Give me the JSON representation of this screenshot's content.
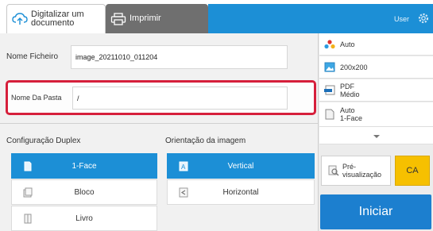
{
  "tabs": {
    "scan_label": "Digitalizar um documento",
    "print_label": "Imprimir"
  },
  "header": {
    "user_label": "User"
  },
  "fields": {
    "file_name_label": "Nome Ficheiro",
    "file_name_value": "image_20211010_011204",
    "folder_name_label": "Nome Da Pasta",
    "folder_name_value": "/"
  },
  "duplex": {
    "title": "Configuração Duplex",
    "options": [
      {
        "label": "1-Face",
        "selected": true
      },
      {
        "label": "Bloco",
        "selected": false
      },
      {
        "label": "Livro",
        "selected": false
      }
    ]
  },
  "orientation": {
    "title": "Orientação da imagem",
    "options": [
      {
        "label": "Vertical",
        "selected": true
      },
      {
        "label": "Horizontal",
        "selected": false
      }
    ]
  },
  "right_panel": {
    "color_mode": "Auto",
    "resolution": "200x200",
    "format_line1": "PDF",
    "format_line2": "Médio",
    "sides_line1": "Auto",
    "sides_line2": "1-Face",
    "preview_line1": "Pré-",
    "preview_line2": "visualização",
    "ca_label": "CA",
    "start_label": "Iniciar"
  },
  "colors": {
    "accent": "#1c8fd6",
    "highlight_border": "#d61f3b",
    "ca_button": "#f6c000",
    "start_button": "#1c7fcf"
  }
}
